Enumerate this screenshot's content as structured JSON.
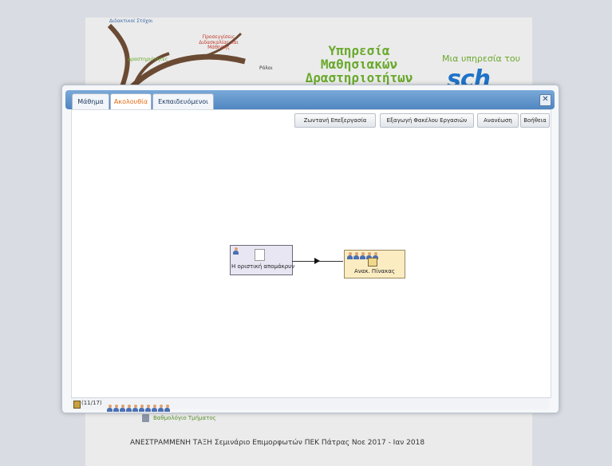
{
  "background_page": {
    "header_labels": [
      "Διδακτικοί Στόχοι",
      "Δραστηριότητες",
      "Προσεγγίσεις Διδασκαλίας και Μάθησης",
      "Ρόλοι"
    ],
    "service_title": [
      "Υπηρεσία",
      "Μαθησιακών",
      "Δραστηριοτήτων"
    ],
    "service_subtitle": "Μια υπηρεσία του",
    "logo_text": "sch",
    "gradebook_link": "Βαθμολόγιο Τμήματος",
    "footer_text": "ΑΝΕΣΤΡΑΜΜΕΝΗ ΤΑΞΗ Σεμινάριο Επιμορφωτών ΠΕΚ Πάτρας Νοε 2017 - Ιαν 2018"
  },
  "dialog": {
    "tabs": [
      {
        "label": "Μάθημα",
        "active": false
      },
      {
        "label": "Ακολουθία",
        "active": true
      },
      {
        "label": "Εκπαιδευόμενοι",
        "active": false
      }
    ],
    "close_symbol": "✕",
    "toolbar": {
      "live_edit": "Ζωντανή Επεξεργασία",
      "export_portfolio": "Εξαγωγή Φακέλου Εργασιών",
      "refresh": "Ανανέωση",
      "help": "Βοήθεια"
    },
    "sequence": {
      "node1": {
        "label": "Η οριστική απομάκρυν",
        "learner_count": 1
      },
      "node2": {
        "label": "Ανακ. Πίνακας",
        "learner_count": 5
      }
    },
    "status": {
      "progress_text": "(11/17)",
      "learner_count": 10
    }
  },
  "colors": {
    "accent_orange": "#e36b12",
    "title_bar_blue": "#5b90c8",
    "service_green": "#6aa92d",
    "logo_blue": "#1f73c8"
  }
}
